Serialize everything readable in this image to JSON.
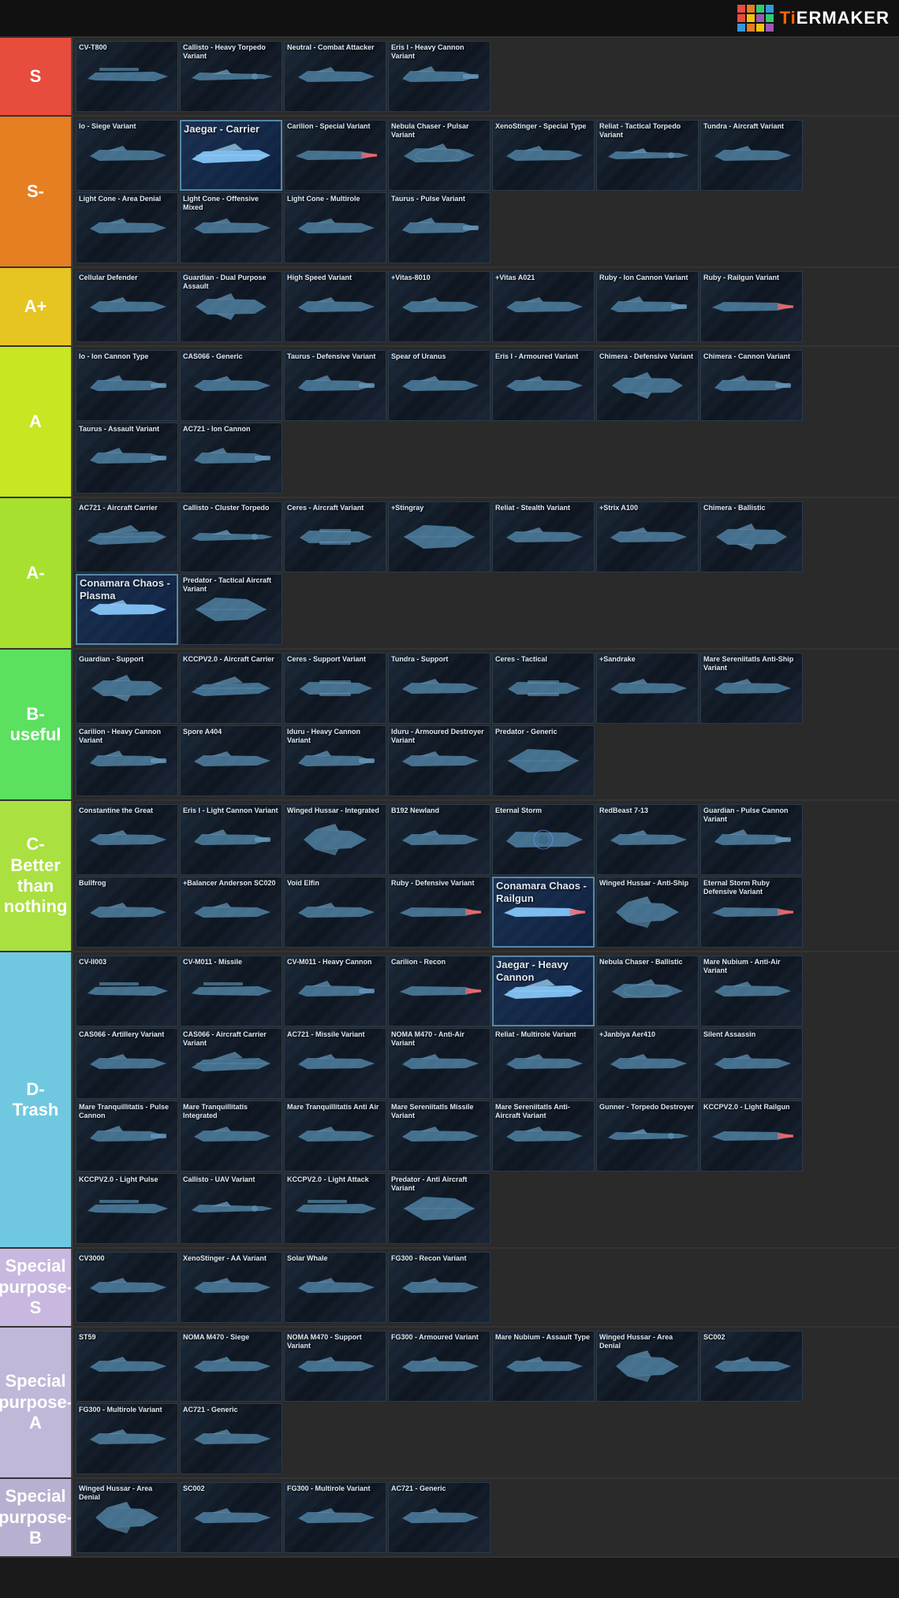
{
  "header": {
    "logo_text": "TiERMAKER",
    "logo_accent": "Ti"
  },
  "tiers": [
    {
      "id": "s",
      "label": "S",
      "color_class": "tier-s",
      "ships": [
        {
          "name": "CV-T800",
          "featured": false
        },
        {
          "name": "Callisto - Heavy Torpedo Variant",
          "featured": false
        },
        {
          "name": "Neutral - Combat Attacker",
          "featured": false
        },
        {
          "name": "Eris I - Heavy Cannon Variant",
          "featured": false
        }
      ]
    },
    {
      "id": "s-minus",
      "label": "S-",
      "color_class": "tier-s-minus",
      "ships": [
        {
          "name": "Io - Siege Variant",
          "featured": false
        },
        {
          "name": "Jaegar - Carrier",
          "featured": true
        },
        {
          "name": "Carilion - Special Variant",
          "featured": false
        },
        {
          "name": "Nebula Chaser - Pulsar Variant",
          "featured": false
        },
        {
          "name": "XenoStinger - Special Type",
          "featured": false
        },
        {
          "name": "Reliat - Tactical Torpedo Variant",
          "featured": false
        },
        {
          "name": "Tundra - Aircraft Variant",
          "featured": false
        },
        {
          "name": "Light Cone - Area Denial",
          "featured": false
        },
        {
          "name": "Light Cone - Offensive Mixed",
          "featured": false
        },
        {
          "name": "Light Cone - Multirole",
          "featured": false
        },
        {
          "name": "Taurus - Pulse Variant",
          "featured": false
        }
      ]
    },
    {
      "id": "a-plus",
      "label": "A+",
      "color_class": "tier-a-plus",
      "ships": [
        {
          "name": "Cellular Defender",
          "featured": false
        },
        {
          "name": "Guardian - Dual Purpose Assault",
          "featured": false
        },
        {
          "name": "High Speed Variant",
          "featured": false
        },
        {
          "name": "+Vitas-8010",
          "featured": false
        },
        {
          "name": "+Vitas A021",
          "featured": false
        },
        {
          "name": "Ruby - Ion Cannon Variant",
          "featured": false
        },
        {
          "name": "Ruby - Railgun Variant",
          "featured": false
        }
      ]
    },
    {
      "id": "a",
      "label": "A",
      "color_class": "tier-a",
      "ships": [
        {
          "name": "Io - Ion Cannon Type",
          "featured": false
        },
        {
          "name": "CAS066 - Generic",
          "featured": false
        },
        {
          "name": "Taurus - Defensive Variant",
          "featured": false
        },
        {
          "name": "Spear of Uranus",
          "featured": false
        },
        {
          "name": "Eris I - Armoured Variant",
          "featured": false
        },
        {
          "name": "Chimera - Defensive Variant",
          "featured": false
        },
        {
          "name": "Chimera - Cannon Variant",
          "featured": false
        },
        {
          "name": "Taurus - Assault Variant",
          "featured": false
        },
        {
          "name": "AC721 - Ion Cannon",
          "featured": false
        }
      ]
    },
    {
      "id": "a-minus",
      "label": "A-",
      "color_class": "tier-a-minus",
      "ships": [
        {
          "name": "AC721 - Aircraft Carrier",
          "featured": false
        },
        {
          "name": "Callisto - Cluster Torpedo",
          "featured": false
        },
        {
          "name": "Ceres - Aircraft Variant",
          "featured": false
        },
        {
          "name": "+Stingray",
          "featured": false
        },
        {
          "name": "Reliat - Stealth Variant",
          "featured": false
        },
        {
          "name": "+Strix A100",
          "featured": false
        },
        {
          "name": "Chimera - Ballistic",
          "featured": false
        },
        {
          "name": "Conamara Chaos - Plasma",
          "featured": true
        },
        {
          "name": "Predator - Tactical Aircraft Variant",
          "featured": false
        }
      ]
    },
    {
      "id": "b-minus",
      "label": "B- useful",
      "color_class": "tier-b-minus",
      "ships": [
        {
          "name": "Guardian - Support",
          "featured": false
        },
        {
          "name": "KCCPV2.0 - Aircraft Carrier",
          "featured": false
        },
        {
          "name": "Ceres - Support Variant",
          "featured": false
        },
        {
          "name": "Tundra - Support",
          "featured": false
        },
        {
          "name": "Ceres - Tactical",
          "featured": false
        },
        {
          "name": "+Sandrake",
          "featured": false
        },
        {
          "name": "Mare Sereniitatls Anti-Ship Variant",
          "featured": false
        },
        {
          "name": "Carilion - Heavy Cannon Variant",
          "featured": false
        },
        {
          "name": "Spore A404",
          "featured": false
        },
        {
          "name": "Iduru - Heavy Cannon Variant",
          "featured": false
        },
        {
          "name": "Iduru - Armoured Destroyer Variant",
          "featured": false
        },
        {
          "name": "Predator - Generic",
          "featured": false
        }
      ]
    },
    {
      "id": "c-minus",
      "label": "C- Better than nothing",
      "color_class": "tier-c-minus",
      "ships": [
        {
          "name": "Constantine the Great",
          "featured": false
        },
        {
          "name": "Eris I - Light Cannon Variant",
          "featured": false
        },
        {
          "name": "Winged Hussar - Integrated",
          "featured": false
        },
        {
          "name": "B192 Newland",
          "featured": false
        },
        {
          "name": "Eternal Storm",
          "featured": false
        },
        {
          "name": "RedBeast 7-13",
          "featured": false
        },
        {
          "name": "Guardian - Pulse Cannon Variant",
          "featured": false
        },
        {
          "name": "Bullfrog",
          "featured": false
        },
        {
          "name": "+Balancer Anderson SC020",
          "featured": false
        },
        {
          "name": "Void Elfin",
          "featured": false
        },
        {
          "name": "Ruby - Defensive Variant",
          "featured": false
        },
        {
          "name": "Conamara Chaos - Railgun",
          "featured": true
        },
        {
          "name": "Winged Hussar - Anti-Ship",
          "featured": false
        },
        {
          "name": "Eternal Storm Ruby Defensive Variant",
          "featured": false
        }
      ]
    },
    {
      "id": "d-minus",
      "label": "D- Trash",
      "color_class": "tier-d-minus",
      "ships": [
        {
          "name": "CV-II003",
          "featured": false
        },
        {
          "name": "CV-M011 - Missile",
          "featured": false
        },
        {
          "name": "CV-M011 - Heavy Cannon",
          "featured": false
        },
        {
          "name": "Carilion - Recon",
          "featured": false
        },
        {
          "name": "Jaegar - Heavy Cannon",
          "featured": true
        },
        {
          "name": "Nebula Chaser - Ballistic",
          "featured": false
        },
        {
          "name": "Mare Nubium - Anti-Air Variant",
          "featured": false
        },
        {
          "name": "CAS066 - Artillery Variant",
          "featured": false
        },
        {
          "name": "CAS066 - Aircraft Carrier Variant",
          "featured": false
        },
        {
          "name": "AC721 - Missile Variant",
          "featured": false
        },
        {
          "name": "NOMA M470 - Anti-Air Variant",
          "featured": false
        },
        {
          "name": "Reliat - Multirole Variant",
          "featured": false
        },
        {
          "name": "+Janbiya Aer410",
          "featured": false
        },
        {
          "name": "Silent Assassin",
          "featured": false
        },
        {
          "name": "Mare Tranquillitatis - Pulse Cannon",
          "featured": false
        },
        {
          "name": "Mare Tranquillitatis Integrated",
          "featured": false
        },
        {
          "name": "Mare Tranquillitatis Anti Air",
          "featured": false
        },
        {
          "name": "Mare Sereniitatls Missile Variant",
          "featured": false
        },
        {
          "name": "Mare Sereniitatls Anti-Aircraft Variant",
          "featured": false
        },
        {
          "name": "Gunner - Torpedo Destroyer",
          "featured": false
        },
        {
          "name": "KCCPV2.0 - Light Railgun",
          "featured": false
        },
        {
          "name": "KCCPV2.0 - Light Pulse",
          "featured": false
        },
        {
          "name": "Callisto - UAV Variant",
          "featured": false
        },
        {
          "name": "KCCPV2.0 - Light Attack",
          "featured": false
        },
        {
          "name": "Predator - Anti Aircraft Variant",
          "featured": false
        }
      ]
    },
    {
      "id": "special-s",
      "label": "Special purpose-S",
      "color_class": "tier-special-s",
      "ships": [
        {
          "name": "CV3000",
          "featured": false
        },
        {
          "name": "XenoStinger - AA Variant",
          "featured": false
        },
        {
          "name": "Solar Whale",
          "featured": false
        },
        {
          "name": "FG300 - Recon Variant",
          "featured": false
        }
      ]
    },
    {
      "id": "special-a",
      "label": "Special purpose-A",
      "color_class": "tier-special-a",
      "ships": [
        {
          "name": "ST59",
          "featured": false
        },
        {
          "name": "NOMA M470 - Siege",
          "featured": false
        },
        {
          "name": "NOMA M470 - Support Variant",
          "featured": false
        },
        {
          "name": "FG300 - Armoured Variant",
          "featured": false
        },
        {
          "name": "Mare Nubium - Assault Type",
          "featured": false
        },
        {
          "name": "Winged Hussar - Area Denial",
          "featured": false
        },
        {
          "name": "SC002",
          "featured": false
        },
        {
          "name": "FG300 - Multirole Variant",
          "featured": false
        },
        {
          "name": "AC721 - Generic",
          "featured": false
        }
      ]
    },
    {
      "id": "special-b",
      "label": "Special purpose-B",
      "color_class": "tier-special-b",
      "ships": [
        {
          "name": "Winged Hussar - Area Denial",
          "featured": false
        },
        {
          "name": "SC002",
          "featured": false
        },
        {
          "name": "FG300 - Multirole Variant",
          "featured": false
        },
        {
          "name": "AC721 - Generic",
          "featured": false
        }
      ]
    }
  ]
}
